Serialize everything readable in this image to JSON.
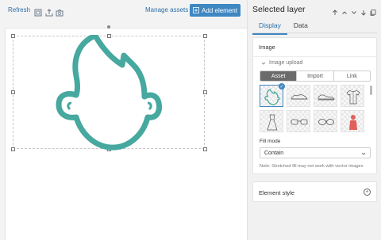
{
  "toolbar": {
    "refresh_label": "Refresh",
    "manage_assets_label": "Manage assets",
    "add_element_label": "Add element",
    "icons": [
      "grid-icon",
      "upload-icon",
      "camera-icon"
    ]
  },
  "panel": {
    "title": "Selected layer",
    "header_icons": [
      "arrow-up-icon",
      "chevron-up-icon",
      "chevron-down-icon",
      "arrow-down-icon",
      "copy-icon"
    ],
    "tabs": [
      {
        "label": "Display",
        "active": true
      },
      {
        "label": "Data",
        "active": false
      }
    ],
    "image_section": {
      "title": "Image",
      "subsection_title": "Image upload",
      "source_options": [
        {
          "label": "Asset",
          "active": true
        },
        {
          "label": "Import",
          "active": false
        },
        {
          "label": "Link",
          "active": false
        }
      ],
      "assets": [
        "face-outline",
        "sneaker-outline",
        "shoe-outline",
        "shirt-outline",
        "dress-outline",
        "glasses-outline",
        "glasses-round-outline",
        "person-red"
      ],
      "fill_mode_label": "Fill mode",
      "fill_mode_value": "Contain",
      "note": "Note: Stretched fill may not work with vector images"
    },
    "element_style_title": "Element style"
  },
  "colors": {
    "accent": "#3f87c1",
    "face_stroke": "#46a89e",
    "person_asset": "#e0605a"
  }
}
